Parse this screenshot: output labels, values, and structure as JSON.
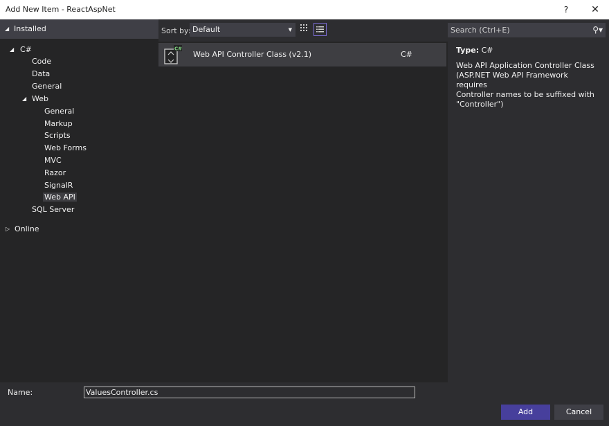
{
  "window": {
    "title": "Add New Item - ReactAspNet",
    "help_label": "?",
    "close_label": "✕"
  },
  "sidebar": {
    "installed_label": "Installed",
    "csharp_label": "C#",
    "items": {
      "code": "Code",
      "data": "Data",
      "general": "General",
      "web": "Web",
      "web_general": "General",
      "markup": "Markup",
      "scripts": "Scripts",
      "web_forms": "Web Forms",
      "mvc": "MVC",
      "razor": "Razor",
      "signalr": "SignalR",
      "web_api": "Web API",
      "sql_server": "SQL Server"
    },
    "online_label": "Online"
  },
  "sort": {
    "label": "Sort by:",
    "value": "Default"
  },
  "templates": [
    {
      "name": "Web API Controller Class (v2.1)",
      "language": "C#"
    }
  ],
  "search": {
    "placeholder": "Search (Ctrl+E)"
  },
  "details": {
    "type_key": "Type:",
    "type_value": "C#",
    "description": "Web API Application Controller Class\n(ASP.NET Web API Framework requires\nController names to be suffixed with\n\"Controller\")"
  },
  "footer": {
    "name_label": "Name:",
    "name_value": "ValuesController.cs",
    "add_label": "Add",
    "cancel_label": "Cancel"
  },
  "colors": {
    "accent": "#473f9c",
    "selection_border": "#7a6cd1",
    "background": "#2d2d30",
    "panel": "#252526"
  }
}
